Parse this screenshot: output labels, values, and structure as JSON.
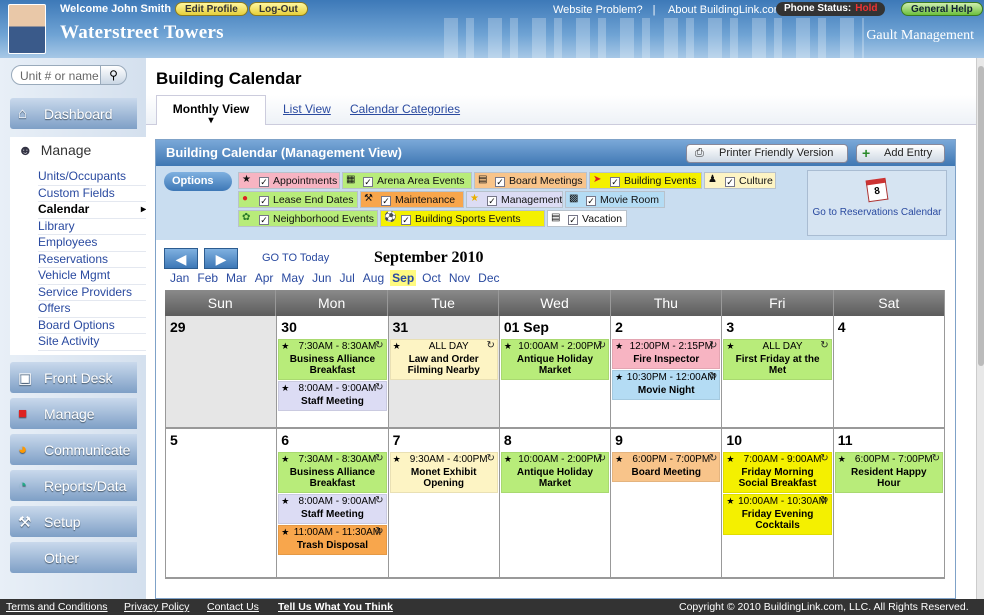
{
  "header": {
    "welcome": "Welcome John Smith",
    "edit_profile": "Edit Profile",
    "logout": "Log-Out",
    "site_name": "Waterstreet Towers",
    "website_problem": "Website Problem?",
    "about": "About BuildingLink.com",
    "phone_status_label": "Phone Status:",
    "phone_status_value": "Hold",
    "general_help": "General Help",
    "management": "Gault Management"
  },
  "sidebar": {
    "search_placeholder": "Unit # or name",
    "dashboard": "Dashboard",
    "manage_header": "Manage",
    "manage_items": [
      "Units/Occupants",
      "Custom Fields",
      "Calendar",
      "Library",
      "Employees",
      "Reservations",
      "Vehicle Mgmt",
      "Service Providers",
      "Offers",
      "Board Options",
      "Site Activity"
    ],
    "nav": [
      "Front Desk",
      "Manage",
      "Communicate",
      "Reports/Data",
      "Setup",
      "Other"
    ]
  },
  "page": {
    "title": "Building Calendar",
    "tabs": [
      "Monthly View",
      "List View",
      "Calendar Categories"
    ],
    "panel_title": "Building Calendar (Management View)",
    "printer_friendly": "Printer Friendly Version",
    "add_entry": "Add Entry",
    "options": "Options",
    "categories": [
      "Appointments",
      "Arena Area Events",
      "Board Meetings",
      "Building Events",
      "Culture",
      "Lease End Dates",
      "Maintenance",
      "Management",
      "Movie Room",
      "Neighborhood Events",
      "Building Sports Events",
      "Vacation"
    ],
    "reservations_link": "Go to Reservations Calendar",
    "go_today": "GO TO Today",
    "month_title": "September 2010",
    "months": [
      "Jan",
      "Feb",
      "Mar",
      "Apr",
      "May",
      "Jun",
      "Jul",
      "Aug",
      "Sep",
      "Oct",
      "Nov",
      "Dec"
    ],
    "selected_month": "Sep",
    "weekdays": [
      "Sun",
      "Mon",
      "Tue",
      "Wed",
      "Thu",
      "Fri",
      "Sat"
    ]
  },
  "calendar": {
    "weeks": [
      [
        {
          "d": "29",
          "gray": true,
          "ev": []
        },
        {
          "d": "30",
          "ev": [
            {
              "time": "7:30AM - 8:30AM",
              "name": "Business Alliance Breakfast",
              "color": "#b8ec7a"
            },
            {
              "time": "8:00AM - 9:00AM",
              "name": "Staff Meeting",
              "color": "#dcdcf4"
            }
          ]
        },
        {
          "d": "31",
          "gray": true,
          "ev": [
            {
              "time": "ALL DAY",
              "name": "Law and Order Filming Nearby",
              "color": "#fdf4c4"
            }
          ]
        },
        {
          "d": "01 Sep",
          "ev": [
            {
              "time": "10:00AM - 2:00PM",
              "name": "Antique Holiday Market",
              "color": "#b8ec7a"
            }
          ]
        },
        {
          "d": "2",
          "ev": [
            {
              "time": "12:00PM - 2:15PM",
              "name": "Fire Inspector",
              "color": "#f7b4c2"
            },
            {
              "time": "10:30PM - 12:00AM",
              "name": "Movie Night",
              "color": "#b4dcf4"
            }
          ]
        },
        {
          "d": "3",
          "ev": [
            {
              "time": "ALL DAY",
              "name": "First Friday at the Met",
              "color": "#b8ec7a"
            }
          ]
        },
        {
          "d": "4",
          "ev": []
        }
      ],
      [
        {
          "d": "5",
          "ev": []
        },
        {
          "d": "6",
          "ev": [
            {
              "time": "7:30AM - 8:30AM",
              "name": "Business Alliance Breakfast",
              "color": "#b8ec7a"
            },
            {
              "time": "8:00AM - 9:00AM",
              "name": "Staff Meeting",
              "color": "#dcdcf4"
            },
            {
              "time": "11:00AM - 11:30AM",
              "name": "Trash Disposal",
              "color": "#f8a64c"
            }
          ]
        },
        {
          "d": "7",
          "ev": [
            {
              "time": "9:30AM - 4:00PM",
              "name": "Monet Exhibit Opening",
              "color": "#fdf4c4"
            }
          ]
        },
        {
          "d": "8",
          "ev": [
            {
              "time": "10:00AM - 2:00PM",
              "name": "Antique Holiday Market",
              "color": "#b8ec7a"
            }
          ]
        },
        {
          "d": "9",
          "ev": [
            {
              "time": "6:00PM - 7:00PM",
              "name": "Board Meeting",
              "color": "#f8c48a"
            }
          ]
        },
        {
          "d": "10",
          "ev": [
            {
              "time": "7:00AM - 9:00AM",
              "name": "Friday Morning Social Breakfast",
              "color": "#f4f000"
            },
            {
              "time": "10:00AM - 10:30AM",
              "name": "Friday Evening Cocktails",
              "color": "#f4f000"
            }
          ]
        },
        {
          "d": "11",
          "ev": [
            {
              "time": "6:00PM - 7:00PM",
              "name": "Resident Happy Hour",
              "color": "#b8ec7a"
            }
          ]
        }
      ]
    ]
  },
  "footer": {
    "terms": "Terms and Conditions",
    "privacy": "Privacy Policy",
    "contact": "Contact Us",
    "tell_us": "Tell Us What You Think",
    "copyright": "Copyright © 2010 BuildingLink.com, LLC. All Rights Reserved."
  }
}
